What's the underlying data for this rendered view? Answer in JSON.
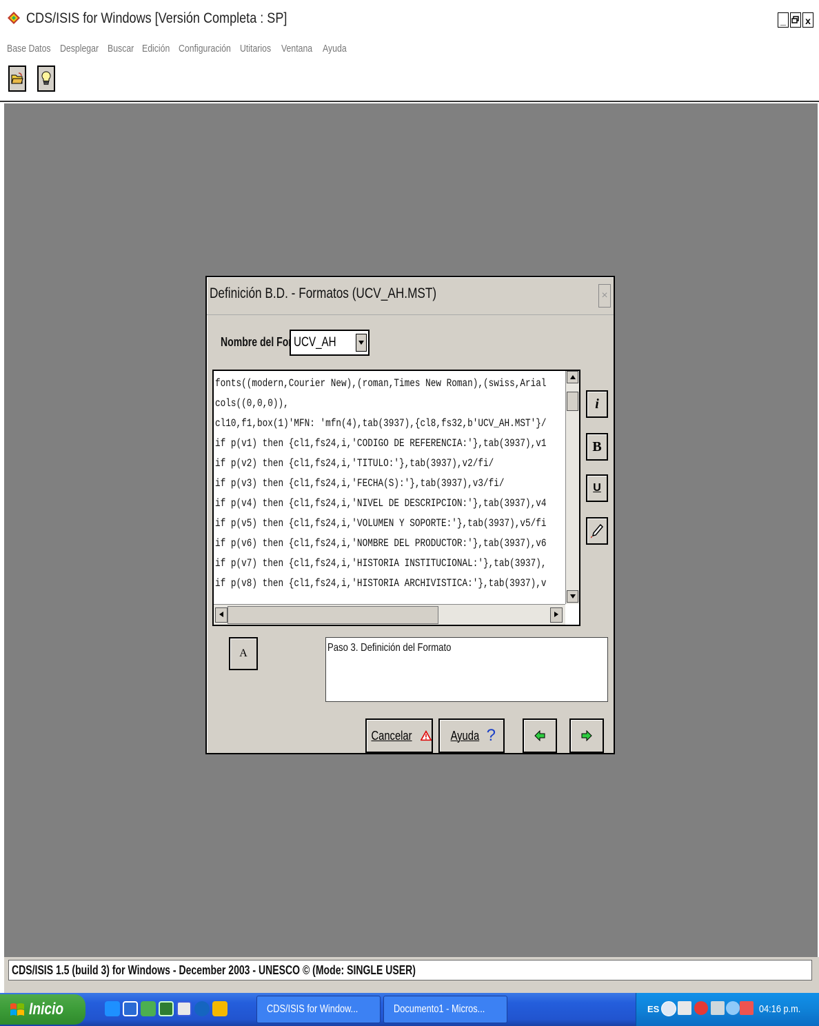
{
  "window": {
    "title": "CDS/ISIS for Windows [Versión Completa : SP]",
    "minimize_glyph": "_",
    "restore_glyph": "🗗",
    "close_glyph": "x"
  },
  "menu": {
    "items": [
      "Base Datos",
      "Desplegar",
      "Buscar",
      "Edición",
      "Configuración",
      "Utitarios",
      "Ventana",
      "Ayuda"
    ]
  },
  "toolbar": {
    "buttons": [
      {
        "name": "open-folder-icon"
      },
      {
        "name": "lightbulb-icon"
      }
    ]
  },
  "dialog": {
    "title": "Definición B.D. - Formatos (UCV_AH.MST)",
    "close_glyph": "×",
    "format_name_label": "Nombre del For",
    "format_name_value": "UCV_AH",
    "code_lines": [
      "fonts((modern,Courier New),(roman,Times New Roman),(swiss,Arial",
      "cols((0,0,0)),",
      "cl10,f1,box(1)'MFN: 'mfn(4),tab(3937),{cl8,fs32,b'UCV_AH.MST'}/",
      "if p(v1) then {cl1,fs24,i,'CODIGO DE REFERENCIA:'},tab(3937),v1",
      "if p(v2) then {cl1,fs24,i,'TITULO:'},tab(3937),v2/fi/",
      "if p(v3) then {cl1,fs24,i,'FECHA(S):'},tab(3937),v3/fi/",
      "if p(v4) then {cl1,fs24,i,'NIVEL DE DESCRIPCION:'},tab(3937),v4",
      "if p(v5) then {cl1,fs24,i,'VOLUMEN Y SOPORTE:'},tab(3937),v5/fi",
      "if p(v6) then {cl1,fs24,i,'NOMBRE DEL PRODUCTOR:'},tab(3937),v6",
      "if p(v7) then {cl1,fs24,i,'HISTORIA INSTITUCIONAL:'},tab(3937),",
      "if p(v8) then {cl1,fs24,i,'HISTORIA ARCHIVISTICA:'},tab(3937),v"
    ],
    "side_buttons": {
      "italic": "i",
      "bold": "B",
      "underline": "U",
      "color": "🖉"
    },
    "font_button_label": "A",
    "help_text": "Paso 3. Definición del Formato",
    "buttons": {
      "cancel": "Cancelar",
      "help": "Ayuda",
      "help_glyph": "?",
      "cancel_glyph": "⚠"
    }
  },
  "status": {
    "text": "CDS/ISIS 1.5 (build 3) for Windows - December 2003 - UNESCO © (Mode: SINGLE USER)"
  },
  "taskbar": {
    "start_label": "Inicio",
    "tasks": [
      {
        "label": "CDS/ISIS for Window..."
      },
      {
        "label": "Documento1 - Micros..."
      }
    ],
    "tray_lang": "ES",
    "clock": "04:16 p.m."
  }
}
